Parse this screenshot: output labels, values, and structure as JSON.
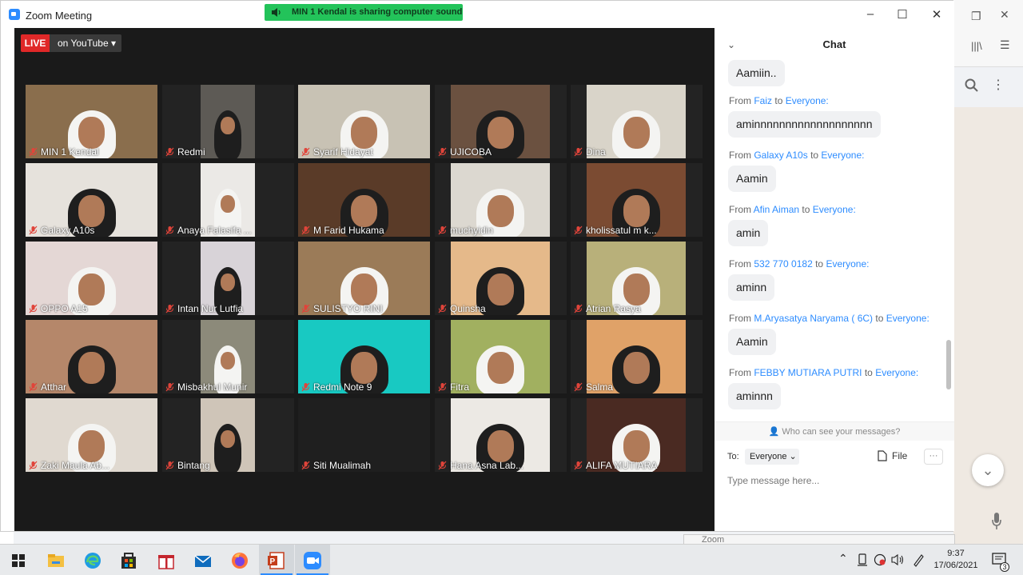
{
  "window": {
    "title": "Zoom Meeting",
    "controls": [
      "–",
      "☐",
      "✕"
    ]
  },
  "share_banner": "MIN 1 Kendal is sharing computer sound",
  "live": {
    "badge": "LIVE",
    "destination": "on YouTube ▾"
  },
  "participants": [
    {
      "name": "MIN 1 Kendal",
      "bg": "#8a6e4d"
    },
    {
      "name": "Redmi",
      "bg": "#5d5a55"
    },
    {
      "name": "Syarif Hidayat",
      "bg": "#c8c2b4"
    },
    {
      "name": "UJICOBA",
      "bg": "#6b5140"
    },
    {
      "name": "Dina",
      "bg": "#d9d4c9"
    },
    {
      "name": "Galaxy A10s",
      "bg": "#e6e2dc"
    },
    {
      "name": "Anaya Falasifa ...",
      "bg": "#ebe9e6"
    },
    {
      "name": "M Farid Hukama",
      "bg": "#5a3b28"
    },
    {
      "name": "muchyidin",
      "bg": "#dcd8d0"
    },
    {
      "name": "kholissatul m k...",
      "bg": "#7b4b32"
    },
    {
      "name": "OPPO A15",
      "bg": "#e4d7d5"
    },
    {
      "name": "Intan Nur Lutfia",
      "bg": "#d8d3d8"
    },
    {
      "name": "SULISTYO RINI",
      "bg": "#9b7b58"
    },
    {
      "name": "Quinsha",
      "bg": "#e5b98a"
    },
    {
      "name": "Atrian Rasya",
      "bg": "#b8b07a"
    },
    {
      "name": "Atthar",
      "bg": "#b5876a"
    },
    {
      "name": "Misbakhul Munir",
      "bg": "#8c8a7a"
    },
    {
      "name": "Redmi Note 9",
      "bg": "#18c9c2"
    },
    {
      "name": "Fitra",
      "bg": "#a1b060"
    },
    {
      "name": "Salma",
      "bg": "#e0a268"
    },
    {
      "name": "Zaki Maula Ab...",
      "bg": "#e0d9d0"
    },
    {
      "name": "Bintang",
      "bg": "#cfc5b8"
    },
    {
      "name": "Siti Mualimah",
      "bg": "#1f1f1f"
    },
    {
      "name": "Hana Asna Lab...",
      "bg": "#ece9e4"
    },
    {
      "name": "ALIFA MUTIARA",
      "bg": "#4a2a22"
    }
  ],
  "chat": {
    "title": "Chat",
    "collapse_icon": "⌄",
    "first_bubble": "Aamiin..",
    "messages": [
      {
        "from_prefix": "From",
        "sender": "Faiz",
        "to_word": "to",
        "recipient": "Everyone:",
        "text": "aminnnnnnnnnnnnnnnnnnn"
      },
      {
        "from_prefix": "From",
        "sender": "Galaxy A10s",
        "to_word": "to",
        "recipient": "Everyone:",
        "text": "Aamin"
      },
      {
        "from_prefix": "From",
        "sender": "Afin Aiman",
        "to_word": "to",
        "recipient": "Everyone:",
        "text": "amin"
      },
      {
        "from_prefix": "From",
        "sender": "532 770 0182",
        "to_word": "to",
        "recipient": "Everyone:",
        "text": "aminn"
      },
      {
        "from_prefix": "From",
        "sender": "M.Aryasatya Naryama ( 6C)",
        "to_word": "to",
        "recipient": "Everyone:",
        "text": "Aamin"
      },
      {
        "from_prefix": "From",
        "sender": "FEBBY MUTIARA PUTRI",
        "to_word": "to",
        "recipient": "Everyone:",
        "text": "aminnn"
      }
    ],
    "who_can_see": "Who can see your messages?",
    "to_label": "To:",
    "to_value": "Everyone ⌄",
    "file_label": "File",
    "more_label": "···",
    "input_placeholder": "Type message here..."
  },
  "mini_preview": "Zoom",
  "taskbar": {
    "time": "9:37",
    "date": "17/06/2021",
    "notification_count": "3",
    "tray_chevron": "⌃"
  },
  "colors": {
    "zoom_blue": "#2d8cff",
    "live_red": "#e02828",
    "share_green": "#23c35a"
  }
}
